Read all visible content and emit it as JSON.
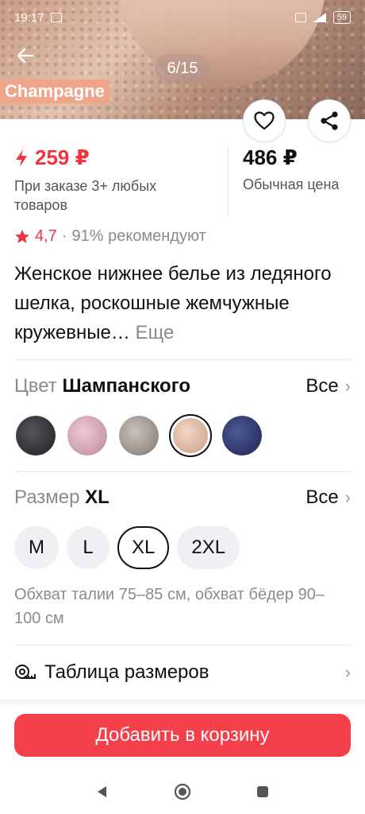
{
  "status": {
    "time": "19:17",
    "battery": "59"
  },
  "hero": {
    "counter": "6/15",
    "color_tag": "Champagne"
  },
  "price": {
    "promo": "259 ₽",
    "promo_note": "При заказе 3+ любых товаров",
    "regular": "486 ₽",
    "regular_note": "Обычная цена"
  },
  "rating": {
    "value": "4,7",
    "recommend": "91% рекомендуют"
  },
  "product": {
    "title": "Женское нижнее белье из ледяного шелка, роскошные жемчужные кружевные…",
    "more": "Еще"
  },
  "color_section": {
    "label": "Цвет",
    "value": "Шампанского",
    "all": "Все",
    "swatches": [
      {
        "name": "black",
        "color": "#2b2b30"
      },
      {
        "name": "pink",
        "color": "#d7a6b8"
      },
      {
        "name": "grey",
        "color": "#a49b94"
      },
      {
        "name": "champagne",
        "color": "#e4bda6"
      },
      {
        "name": "navy",
        "color": "#2b3566"
      }
    ]
  },
  "size_section": {
    "label": "Размер",
    "value": "XL",
    "all": "Все",
    "options": [
      "M",
      "L",
      "XL",
      "2XL"
    ],
    "info": "Обхват талии 75–85 см, обхват бёдер 90–100 см"
  },
  "size_table": "Таблица размеров",
  "cart_button": "Добавить в корзину",
  "colors": {
    "accent": "#f4404a",
    "muted": "#8a8a92"
  }
}
